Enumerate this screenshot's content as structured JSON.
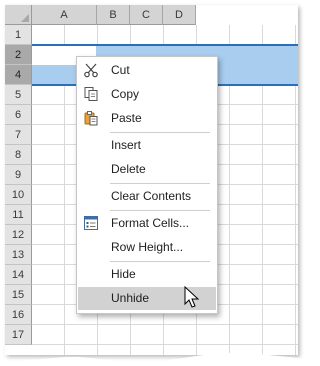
{
  "columns": [
    "A",
    "B",
    "C",
    "D"
  ],
  "rows": [
    "1",
    "2",
    "4",
    "5",
    "6",
    "7",
    "8",
    "9",
    "10",
    "11",
    "12",
    "13",
    "14",
    "15",
    "16",
    "17"
  ],
  "context_menu": {
    "items": [
      {
        "label": "Cut",
        "icon": "scissors-icon"
      },
      {
        "label": "Copy",
        "icon": "copy-icon"
      },
      {
        "label": "Paste",
        "icon": "paste-icon"
      },
      {
        "label": "Insert"
      },
      {
        "label": "Delete"
      },
      {
        "label": "Clear Contents"
      },
      {
        "label": "Format Cells...",
        "icon": "format-cells-icon"
      },
      {
        "label": "Row Height..."
      },
      {
        "label": "Hide"
      },
      {
        "label": "Unhide"
      }
    ]
  },
  "colors": {
    "selection": "#a9cdef",
    "hidden_row_marker": "#2b70b6",
    "header": "#d4d4d4",
    "selected_header": "#a9a9a9",
    "menu_hover": "#d2d2d2"
  }
}
